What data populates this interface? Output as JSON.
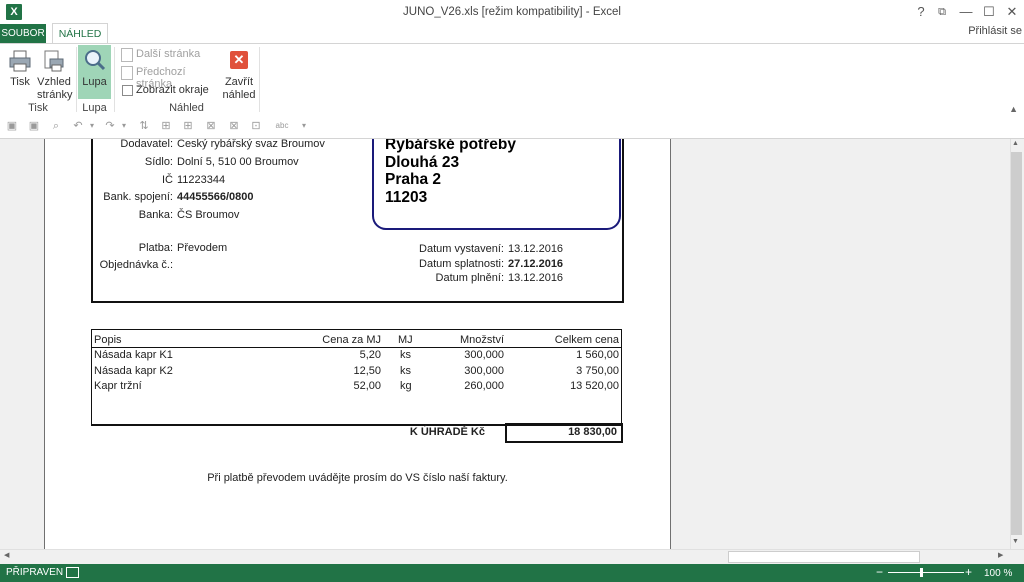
{
  "window": {
    "title": "JUNO_V26.xls  [režim kompatibility] - Excel",
    "help": "?",
    "restore_ribbon": "⧉",
    "minimize": "—",
    "maximize": "☐",
    "close": "✕"
  },
  "tabs": {
    "file": "SOUBOR",
    "preview": "NÁHLED",
    "signin": "Přihlásit se"
  },
  "ribbon": {
    "print_label": "Tisk",
    "page_setup_line1": "Vzhled",
    "page_setup_line2": "stránky",
    "zoom_label": "Lupa",
    "next_page": "Další stránka",
    "prev_page": "Předchozí stránka",
    "show_margins": "Zobrazit okraje",
    "close_line1": "Zavřít",
    "close_line2": "náhled",
    "group_print": "Tisk",
    "group_zoom": "Lupa",
    "group_preview": "Náhled"
  },
  "invoice": {
    "supplier_label": "Dodavatel:",
    "supplier_value": "Český rybářský svaz Broumov",
    "address_label": "Sídlo:",
    "address_value": "Dolní 5, 510 00 Broumov",
    "ico_label": "IČ",
    "ico_value": "11223344",
    "bank_label": "Bank. spojení:",
    "bank_value": "44455566/0800",
    "bank_name_label": "Banka:",
    "bank_name_value": "ČS Broumov",
    "payment_label": "Platba:",
    "payment_value": "Převodem",
    "order_label": "Objednávka č.:",
    "customer_name": "Rybářské potřeby",
    "customer_street": "Dlouhá 23",
    "customer_city": "Praha 2",
    "customer_zip": "11203",
    "issue_label": "Datum vystavení:",
    "issue_value": "13.12.2016",
    "due_label": "Datum splatnosti:",
    "due_value": "27.12.2016",
    "fulfil_label": "Datum plnění:",
    "fulfil_value": "13.12.2016",
    "table_headers": {
      "desc": "Popis",
      "unit_price": "Cena za MJ",
      "unit": "MJ",
      "qty": "Množství",
      "total": "Celkem cena"
    },
    "rows": [
      {
        "desc": "Násada kapr K1",
        "unit_price": "5,20",
        "unit": "ks",
        "qty": "300,000",
        "total": "1 560,00"
      },
      {
        "desc": "Násada kapr K2",
        "unit_price": "12,50",
        "unit": "ks",
        "qty": "300,000",
        "total": "3 750,00"
      },
      {
        "desc": "Kapr tržní",
        "unit_price": "52,00",
        "unit": "kg",
        "qty": "260,000",
        "total": "13 520,00"
      }
    ],
    "to_pay_label": "K ÚHRADĚ Kč",
    "to_pay_value": "18 830,00",
    "footer_note": "Při platbě převodem uvádějte prosím do VS číslo naší faktury."
  },
  "status": {
    "mode": "PŘIPRAVEN",
    "zoom_percent": "100 %",
    "zoom_minus": "−",
    "zoom_plus": "+"
  }
}
